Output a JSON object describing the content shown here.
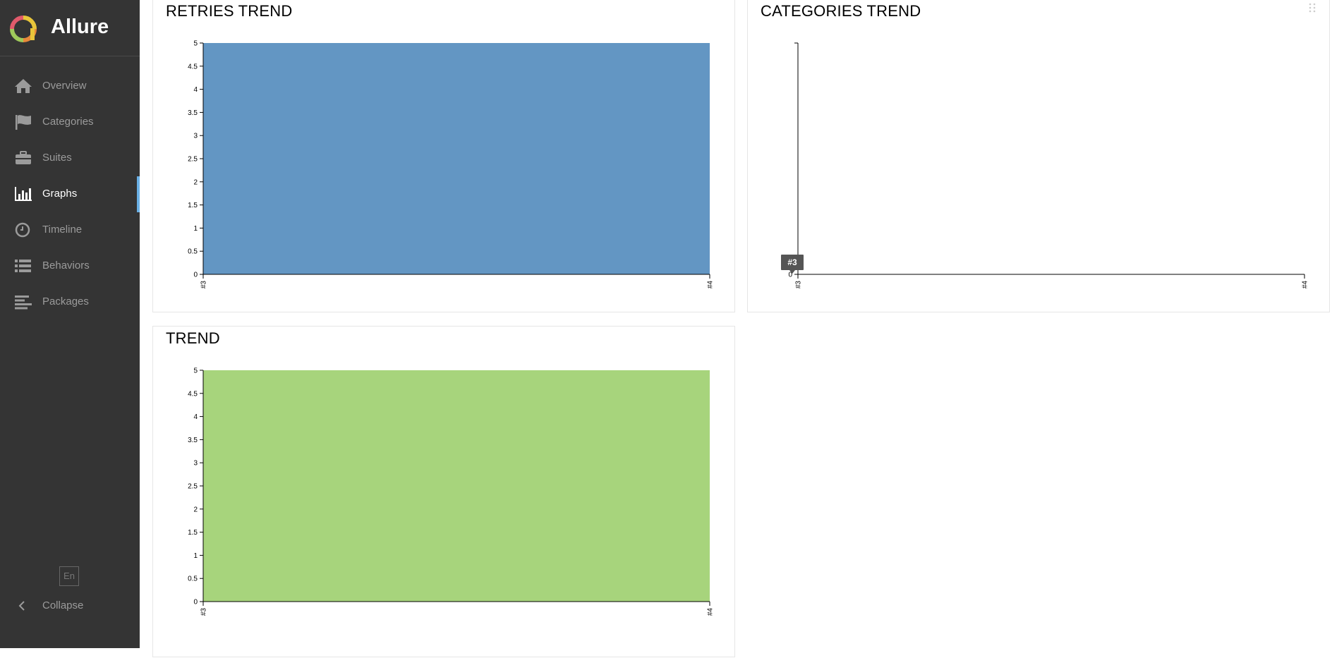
{
  "app": {
    "brand": "Allure",
    "language_button": "En",
    "collapse_label": "Collapse"
  },
  "sidebar": {
    "items": [
      {
        "label": "Overview",
        "icon": "home-icon",
        "active": false
      },
      {
        "label": "Categories",
        "icon": "flag-icon",
        "active": false
      },
      {
        "label": "Suites",
        "icon": "briefcase-icon",
        "active": false
      },
      {
        "label": "Graphs",
        "icon": "bar-chart-icon",
        "active": true
      },
      {
        "label": "Timeline",
        "icon": "clock-icon",
        "active": false
      },
      {
        "label": "Behaviors",
        "icon": "list-icon",
        "active": false
      },
      {
        "label": "Packages",
        "icon": "align-left-icon",
        "active": false
      }
    ]
  },
  "widgets": {
    "retries": {
      "title": "RETRIES TREND"
    },
    "categories": {
      "title": "CATEGORIES TREND",
      "tooltip": "#3"
    },
    "trend": {
      "title": "TREND"
    }
  },
  "colors": {
    "sidebar_bg": "#343434",
    "active_accent": "#6ab0e6",
    "retries_fill": "#6396c3",
    "trend_fill": "#a7d47c"
  },
  "chart_data": [
    {
      "type": "area",
      "title": "RETRIES TREND",
      "categories": [
        "#3",
        "#4"
      ],
      "series": [
        {
          "values": [
            5,
            5
          ]
        }
      ],
      "ylim": [
        0,
        5
      ],
      "yticks": [
        "0",
        "0.5",
        "1",
        "1.5",
        "2",
        "2.5",
        "3",
        "3.5",
        "4",
        "4.5",
        "5"
      ],
      "color": "#6396c3"
    },
    {
      "type": "area",
      "title": "CATEGORIES TREND",
      "categories": [
        "#3",
        "#4"
      ],
      "series": [],
      "yticks": [
        "0"
      ],
      "tooltip": "#3"
    },
    {
      "type": "area",
      "title": "TREND",
      "categories": [
        "#3",
        "#4"
      ],
      "series": [
        {
          "values": [
            5,
            5
          ]
        }
      ],
      "ylim": [
        0,
        5
      ],
      "yticks": [
        "0",
        "0.5",
        "1",
        "1.5",
        "2",
        "2.5",
        "3",
        "3.5",
        "4",
        "4.5",
        "5"
      ],
      "color": "#a7d47c"
    }
  ]
}
